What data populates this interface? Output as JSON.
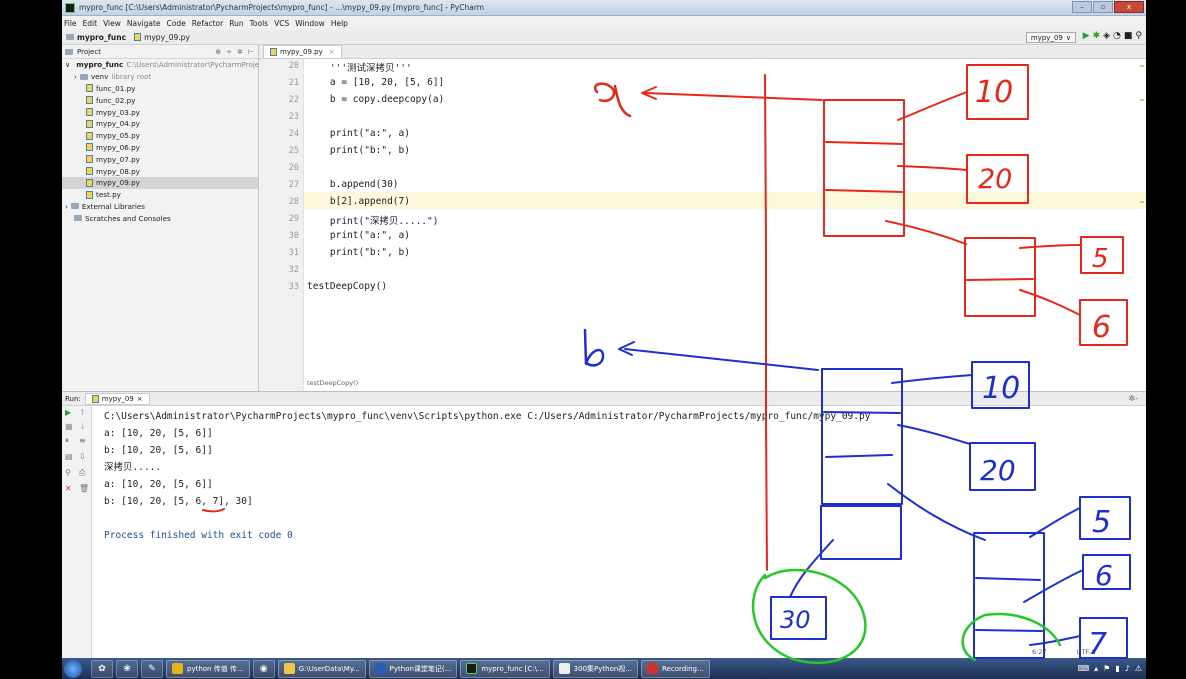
{
  "window": {
    "title": "mypro_func [C:\\Users\\Administrator\\PycharmProjects\\mypro_func] - ...\\mypy_09.py [mypro_func] - PyCharm",
    "minimize": "–",
    "maximize": "▫",
    "close": "x"
  },
  "menu": [
    "File",
    "Edit",
    "View",
    "Navigate",
    "Code",
    "Refactor",
    "Run",
    "Tools",
    "VCS",
    "Window",
    "Help"
  ],
  "navbar": {
    "project": "mypro_func",
    "file": "mypy_09.py",
    "run_config": "mypy_09",
    "run_config_arrow": "∨"
  },
  "project_panel": {
    "title": "Project",
    "root": {
      "name": "mypro_func",
      "path": "C:\\Users\\Administrator\\PycharmProject"
    },
    "items": [
      {
        "name": "venv",
        "note": "library root",
        "type": "folder"
      },
      {
        "name": "func_01.py",
        "type": "file"
      },
      {
        "name": "func_02.py",
        "type": "file"
      },
      {
        "name": "mypy_03.py",
        "type": "file"
      },
      {
        "name": "mypy_04.py",
        "type": "file"
      },
      {
        "name": "mypy_05.py",
        "type": "file"
      },
      {
        "name": "mypy_06.py",
        "type": "file"
      },
      {
        "name": "mypy_07.py",
        "type": "file"
      },
      {
        "name": "mypy_08.py",
        "type": "file"
      },
      {
        "name": "mypy_09.py",
        "type": "file",
        "selected": true
      },
      {
        "name": "test.py",
        "type": "file"
      }
    ],
    "external_libraries": "External Libraries",
    "scratches": "Scratches and Consoles"
  },
  "editor": {
    "tab": "mypy_09.py",
    "tab_close": "×",
    "lines": [
      {
        "n": "20",
        "text": "    '''测试深拷贝'''"
      },
      {
        "n": "21",
        "text": "    a = [10, 20, [5, 6]]"
      },
      {
        "n": "22",
        "text": "    b = copy.deepcopy(a)"
      },
      {
        "n": "23",
        "text": ""
      },
      {
        "n": "24",
        "text": "    print(\"a:\", a)"
      },
      {
        "n": "25",
        "text": "    print(\"b:\", b)"
      },
      {
        "n": "26",
        "text": ""
      },
      {
        "n": "27",
        "text": "    b.append(30)"
      },
      {
        "n": "28",
        "text": "    b[2].append(7)"
      },
      {
        "n": "29",
        "text": "    print(\"深拷贝.....\")"
      },
      {
        "n": "30",
        "text": "    print(\"a:\", a)"
      },
      {
        "n": "31",
        "text": "    print(\"b:\", b)"
      },
      {
        "n": "32",
        "text": ""
      },
      {
        "n": "33",
        "text": "testDeepCopy()"
      }
    ],
    "breadcrumb": "testDeepCopy()"
  },
  "run": {
    "label": "Run:",
    "tab": "mypy_09",
    "gear": "✲-",
    "output": [
      "C:\\Users\\Administrator\\PycharmProjects\\mypro_func\\venv\\Scripts\\python.exe C:/Users/Administrator/PycharmProjects/mypro_func/mypy_09.py",
      "a: [10, 20, [5, 6]]",
      "b: [10, 20, [5, 6]]",
      "深拷贝.....",
      "a: [10, 20, [5, 6]]",
      "b: [10, 20, [5, 6, 7], 30]",
      "",
      "Process finished with exit code 0"
    ]
  },
  "status": {
    "position": "6:27",
    "encoding": "UTF-8"
  },
  "taskbar": {
    "items": [
      "python 传值 传...",
      "G:\\UserData\\My...",
      "Python课堂笔记(...",
      "mypro_func [C:\\...",
      "300集Python视...",
      "Recording..."
    ]
  },
  "annotations": {
    "red_labels": [
      "a",
      "10",
      "20",
      "5",
      "6"
    ],
    "blue_labels": [
      "b",
      "10",
      "20",
      "5",
      "6",
      "7",
      "30"
    ],
    "colors": {
      "red": "#e8261a",
      "blue": "#1e2fd2",
      "green": "#26c926"
    }
  }
}
